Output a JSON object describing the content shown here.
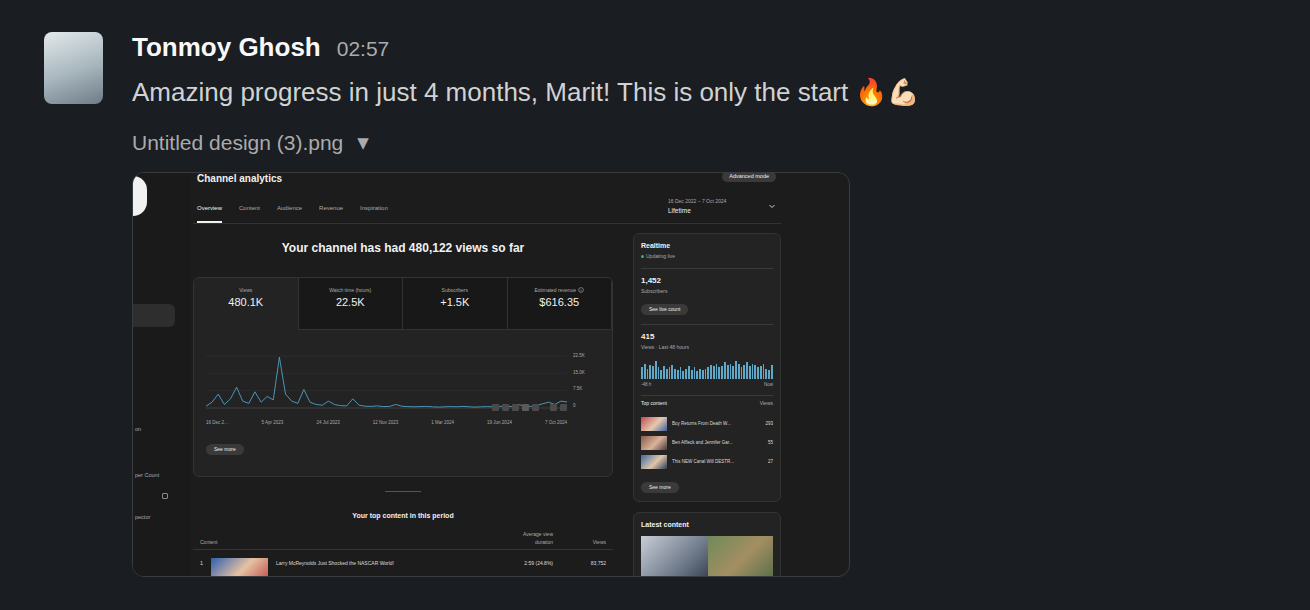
{
  "message": {
    "author": "Tonmoy Ghosh",
    "time": "02:57",
    "text": "Amazing progress in just 4 months, Marit! This is only the start 🔥💪🏻",
    "attachment": {
      "filename": "Untitled design (3).png",
      "toggle": "▼"
    }
  },
  "analytics": {
    "sidebar": {
      "items": [
        {
          "label": "on"
        },
        {
          "label": "per Count"
        },
        {
          "label": "pector"
        }
      ]
    },
    "title": "Channel analytics",
    "advanced_button": "Advanced mode",
    "tabs": [
      {
        "label": "Overview",
        "selected": true
      },
      {
        "label": "Content",
        "selected": false
      },
      {
        "label": "Audience",
        "selected": false
      },
      {
        "label": "Revenue",
        "selected": false
      },
      {
        "label": "Inspiration",
        "selected": false
      }
    ],
    "date_range": {
      "range": "16 Dec 2022 – 7 Oct 2024",
      "period": "Lifetime"
    },
    "headline": "Your channel has had 480,122 views so far",
    "metrics": [
      {
        "label": "Views",
        "value": "480.1K",
        "selected": true
      },
      {
        "label": "Watch time (hours)",
        "value": "22.5K",
        "selected": false
      },
      {
        "label": "Subscribers",
        "value": "+1.5K",
        "selected": false
      },
      {
        "label": "Estimated revenue",
        "value": "$616.35",
        "selected": false
      }
    ],
    "chart": {
      "y_ticks": [
        "22.5K",
        "15.0K",
        "7.5K",
        "0"
      ],
      "y_max": 22500,
      "x_ticks": [
        "16 Dec 2…",
        "5 Apr 2023",
        "24 Jul 2023",
        "12 Nov 2023",
        "1 Mar 2024",
        "19 Jun 2024",
        "7 Oct 2024"
      ],
      "series": [
        800,
        2500,
        6000,
        1500,
        4000,
        9000,
        3000,
        2000,
        7000,
        2500,
        5000,
        3500,
        22000,
        6000,
        3000,
        2000,
        8000,
        2500,
        1500,
        1200,
        3000,
        1500,
        1000,
        900,
        4000,
        1200,
        800,
        700,
        900,
        600,
        700,
        1500,
        800,
        600,
        500,
        600,
        700,
        500,
        400,
        500,
        600,
        500,
        700,
        500,
        400,
        500,
        600,
        500,
        700,
        800,
        600,
        1500,
        900,
        700,
        1000,
        1800,
        2500,
        1500,
        3000,
        2600
      ]
    },
    "see_more": "See more",
    "top_content": {
      "title": "Your top content in this period",
      "columns": [
        "Content",
        "Average view duration",
        "Views"
      ],
      "rows": [
        {
          "rank": "1",
          "title": "Larry McReynolds Just Shocked the NASCAR World!",
          "duration": "2:59 (24.8%)",
          "views": "83,752"
        }
      ]
    },
    "realtime": {
      "title": "Realtime",
      "status": "Updating live",
      "subscribers": "1,452",
      "subscribers_label": "Subscribers",
      "live_button": "See live count",
      "views": "415",
      "views_label": "Views · Last 48 hours",
      "bars": [
        9,
        12,
        8,
        11,
        10,
        14,
        9,
        7,
        10,
        8,
        9,
        11,
        8,
        7,
        9,
        6,
        8,
        10,
        7,
        9,
        6,
        8,
        7,
        8,
        9,
        11,
        10,
        12,
        9,
        10,
        13,
        11,
        12,
        10,
        14,
        12,
        9,
        11,
        13,
        10,
        12,
        11,
        9,
        10,
        12,
        8,
        7,
        11
      ],
      "axis_start": "-48 h",
      "axis_end": "Now",
      "top_title": "Top content",
      "top_views": "Views",
      "top": [
        {
          "title": "Boy Returns From Death W...",
          "views": "293"
        },
        {
          "title": "Ben Affleck and Jennifer Gar...",
          "views": "55"
        },
        {
          "title": "This NEW Canal Will DESTR...",
          "views": "27"
        }
      ],
      "see_more": "See more"
    },
    "latest": {
      "title": "Latest content"
    }
  }
}
